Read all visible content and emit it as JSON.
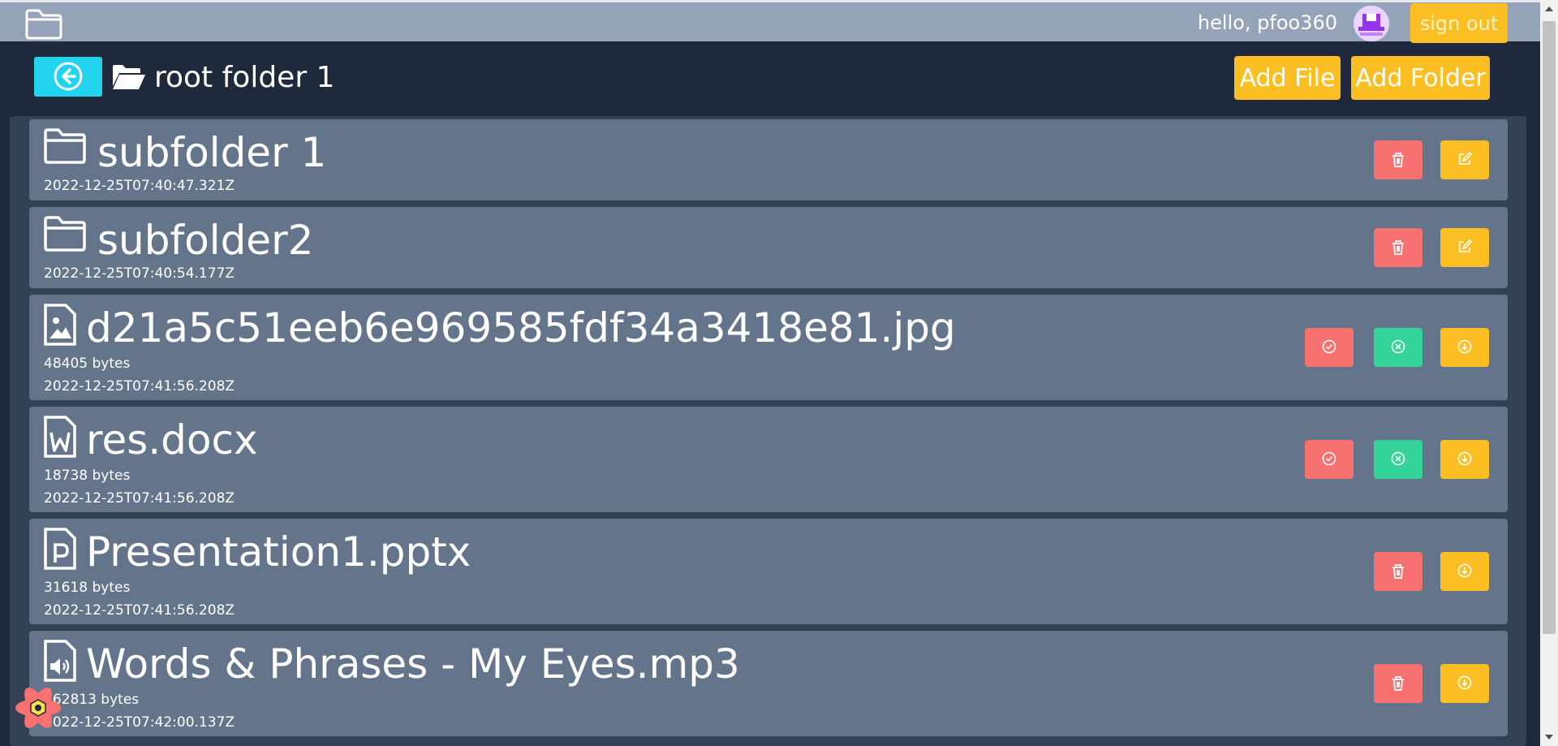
{
  "topbar": {
    "greeting": "hello, pfoo360",
    "signout_label": "sign out",
    "logo_icon": "folder-icon"
  },
  "header": {
    "title": "root folder 1",
    "add_file_label": "Add File",
    "add_folder_label": "Add Folder"
  },
  "items": [
    {
      "type": "folder",
      "name": "subfolder 1",
      "date": "2022-12-25T07:40:47.321Z"
    },
    {
      "type": "folder",
      "name": "subfolder2",
      "date": "2022-12-25T07:40:54.177Z"
    },
    {
      "type": "image",
      "name": "d21a5c51eeb6e969585fdf34a3418e81.jpg",
      "size": "48405 bytes",
      "date": "2022-12-25T07:41:56.208Z"
    },
    {
      "type": "word",
      "name": "res.docx",
      "size": "18738 bytes",
      "date": "2022-12-25T07:41:56.208Z"
    },
    {
      "type": "powerpoint",
      "name": "Presentation1.pptx",
      "size": "31618 bytes",
      "date": "2022-12-25T07:41:56.208Z"
    },
    {
      "type": "audio",
      "name": "Words & Phrases - My Eyes.mp3",
      "size": "262813 bytes",
      "date": "2022-12-25T07:42:00.137Z"
    }
  ],
  "colors": {
    "background": "#1e293b",
    "topbar": "#94a3b8",
    "row": "#64748b",
    "accent_cyan": "#22d3ee",
    "accent_yellow": "#fbbf24",
    "danger_red": "#f87171",
    "success_green": "#34d399"
  }
}
